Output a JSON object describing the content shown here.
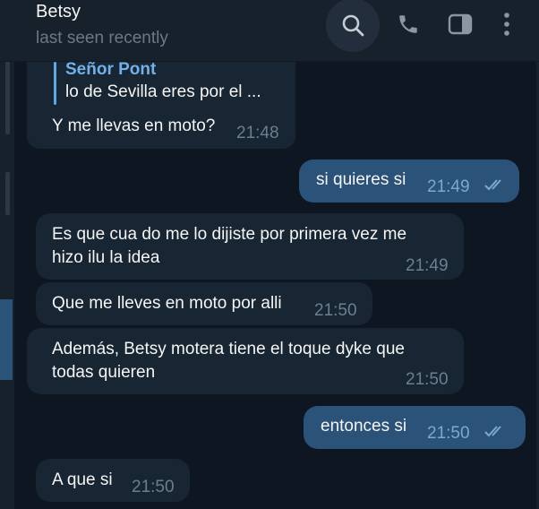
{
  "header": {
    "contact_name": "Betsy",
    "status": "last seen recently"
  },
  "colors": {
    "background": "#0e1621",
    "incoming_bubble": "#182533",
    "outgoing_bubble": "#2b5278",
    "accent": "#71b1ea"
  },
  "messages": [
    {
      "direction": "incoming",
      "reply_to": {
        "author": "Señor Pont",
        "text": "lo de Sevilla eres por el ..."
      },
      "text": "Y me llevas en moto?",
      "time": "21:48"
    },
    {
      "direction": "outgoing",
      "text": "si quieres si",
      "time": "21:49",
      "read": true
    },
    {
      "direction": "incoming",
      "lines": [
        "Es que cua do me lo dijiste por primera vez me",
        "hizo ilu la idea"
      ],
      "time": "21:49"
    },
    {
      "direction": "incoming",
      "text": "Que me lleves en moto por alli",
      "time": "21:50"
    },
    {
      "direction": "incoming",
      "lines": [
        "Además, Betsy motera tiene el toque dyke que",
        "todas quieren"
      ],
      "time": "21:50"
    },
    {
      "direction": "outgoing",
      "text": "entonces si",
      "time": "21:50",
      "read": true
    },
    {
      "direction": "incoming",
      "text": "A que si",
      "time": "21:50"
    }
  ]
}
